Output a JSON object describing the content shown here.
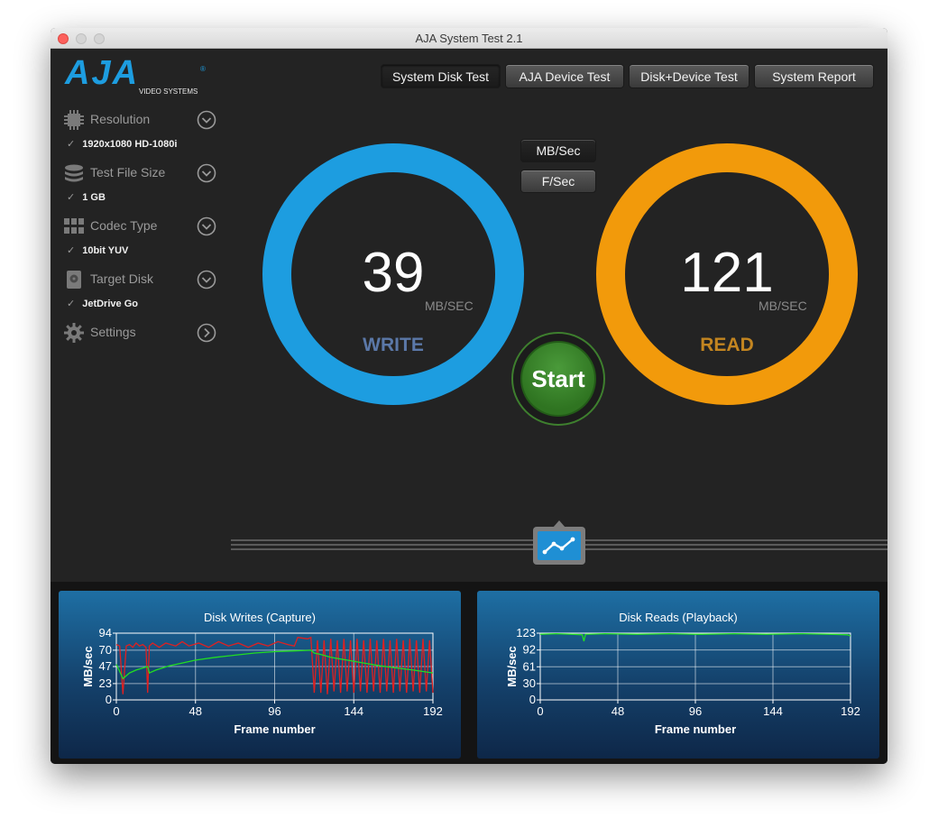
{
  "window": {
    "title": "AJA System Test 2.1"
  },
  "logo": {
    "brand": "AJA",
    "tagline": "VIDEO SYSTEMS",
    "color": "#1d9de0"
  },
  "top_tabs": [
    {
      "label": "System Disk Test",
      "active": true
    },
    {
      "label": "AJA Device Test",
      "active": false
    },
    {
      "label": "Disk+Device Test",
      "active": false
    },
    {
      "label": "System Report",
      "active": false
    }
  ],
  "sidebar": {
    "resolution": {
      "label": "Resolution",
      "value": "1920x1080 HD-1080i",
      "icon": "chip-icon"
    },
    "file_size": {
      "label": "Test File Size",
      "value": "1 GB",
      "icon": "stack-icon"
    },
    "codec": {
      "label": "Codec Type",
      "value": "10bit YUV",
      "icon": "grid-icon"
    },
    "target": {
      "label": "Target Disk",
      "value": "JetDrive Go",
      "icon": "disk-icon"
    },
    "settings": {
      "label": "Settings",
      "icon": "gear-icon"
    },
    "check": "✓"
  },
  "units": {
    "mb_sec": "MB/Sec",
    "f_sec": "F/Sec",
    "selected": "MB/Sec"
  },
  "write": {
    "value": "39",
    "unit": "MB/SEC",
    "label": "WRITE",
    "color": "#1d9de0"
  },
  "read": {
    "value": "121",
    "unit": "MB/SEC",
    "label": "READ",
    "color": "#f29a0b"
  },
  "start_button": {
    "label": "Start"
  },
  "chart_data": [
    {
      "type": "line",
      "title": "Disk Writes (Capture)",
      "xlabel": "Frame number",
      "ylabel": "MB/sec",
      "xlim": [
        0,
        192
      ],
      "ylim": [
        0,
        94
      ],
      "xticks": [
        0,
        48,
        96,
        144,
        192
      ],
      "yticks": [
        0,
        23,
        47,
        70,
        94
      ],
      "grid": true,
      "series": [
        {
          "color": "#e02020",
          "x": [
            0,
            2,
            4,
            6,
            8,
            10,
            12,
            14,
            16,
            18,
            19,
            20,
            22,
            26,
            30,
            36,
            40,
            44,
            50,
            56,
            62,
            68,
            74,
            80,
            86,
            92,
            98,
            104,
            108,
            110,
            116,
            118,
            120,
            122,
            124,
            126,
            128,
            130,
            132,
            134,
            136,
            138,
            140,
            142,
            144,
            146,
            148,
            150,
            152,
            154,
            156,
            158,
            160,
            162,
            164,
            166,
            168,
            170,
            172,
            174,
            176,
            178,
            180,
            182,
            184,
            186,
            188,
            190,
            192
          ],
          "y": [
            78,
            76,
            8,
            76,
            78,
            74,
            80,
            76,
            78,
            74,
            10,
            76,
            80,
            74,
            80,
            76,
            82,
            76,
            80,
            74,
            82,
            76,
            80,
            74,
            80,
            76,
            82,
            78,
            76,
            88,
            86,
            88,
            10,
            84,
            10,
            84,
            8,
            86,
            12,
            84,
            10,
            86,
            12,
            84,
            10,
            86,
            12,
            84,
            10,
            86,
            12,
            84,
            10,
            86,
            12,
            84,
            10,
            86,
            12,
            84,
            10,
            86,
            12,
            84,
            10,
            86,
            12,
            84,
            10
          ]
        },
        {
          "color": "#22dd22",
          "x": [
            0,
            2,
            4,
            8,
            12,
            16,
            19,
            20,
            24,
            32,
            40,
            48,
            60,
            72,
            84,
            96,
            108,
            118,
            120,
            124,
            130,
            140,
            150,
            160,
            170,
            180,
            192
          ],
          "y": [
            50,
            40,
            30,
            38,
            42,
            45,
            47,
            38,
            42,
            48,
            52,
            56,
            60,
            63,
            66,
            68,
            69,
            70,
            66,
            64,
            60,
            56,
            52,
            48,
            45,
            42,
            38
          ]
        }
      ]
    },
    {
      "type": "line",
      "title": "Disk Reads (Playback)",
      "xlabel": "Frame number",
      "ylabel": "MB/sec",
      "xlim": [
        0,
        192
      ],
      "ylim": [
        0,
        123
      ],
      "xticks": [
        0,
        48,
        96,
        144,
        192
      ],
      "yticks": [
        0,
        30,
        61,
        92,
        123
      ],
      "grid": true,
      "series": [
        {
          "color": "#22dd22",
          "x": [
            0,
            10,
            20,
            26,
            27,
            28,
            40,
            60,
            80,
            96,
            100,
            120,
            140,
            160,
            180,
            190,
            192
          ],
          "y": [
            121,
            122,
            121,
            120,
            108,
            121,
            122,
            121,
            122,
            121,
            121,
            122,
            121,
            122,
            121,
            120,
            118
          ]
        }
      ]
    }
  ]
}
